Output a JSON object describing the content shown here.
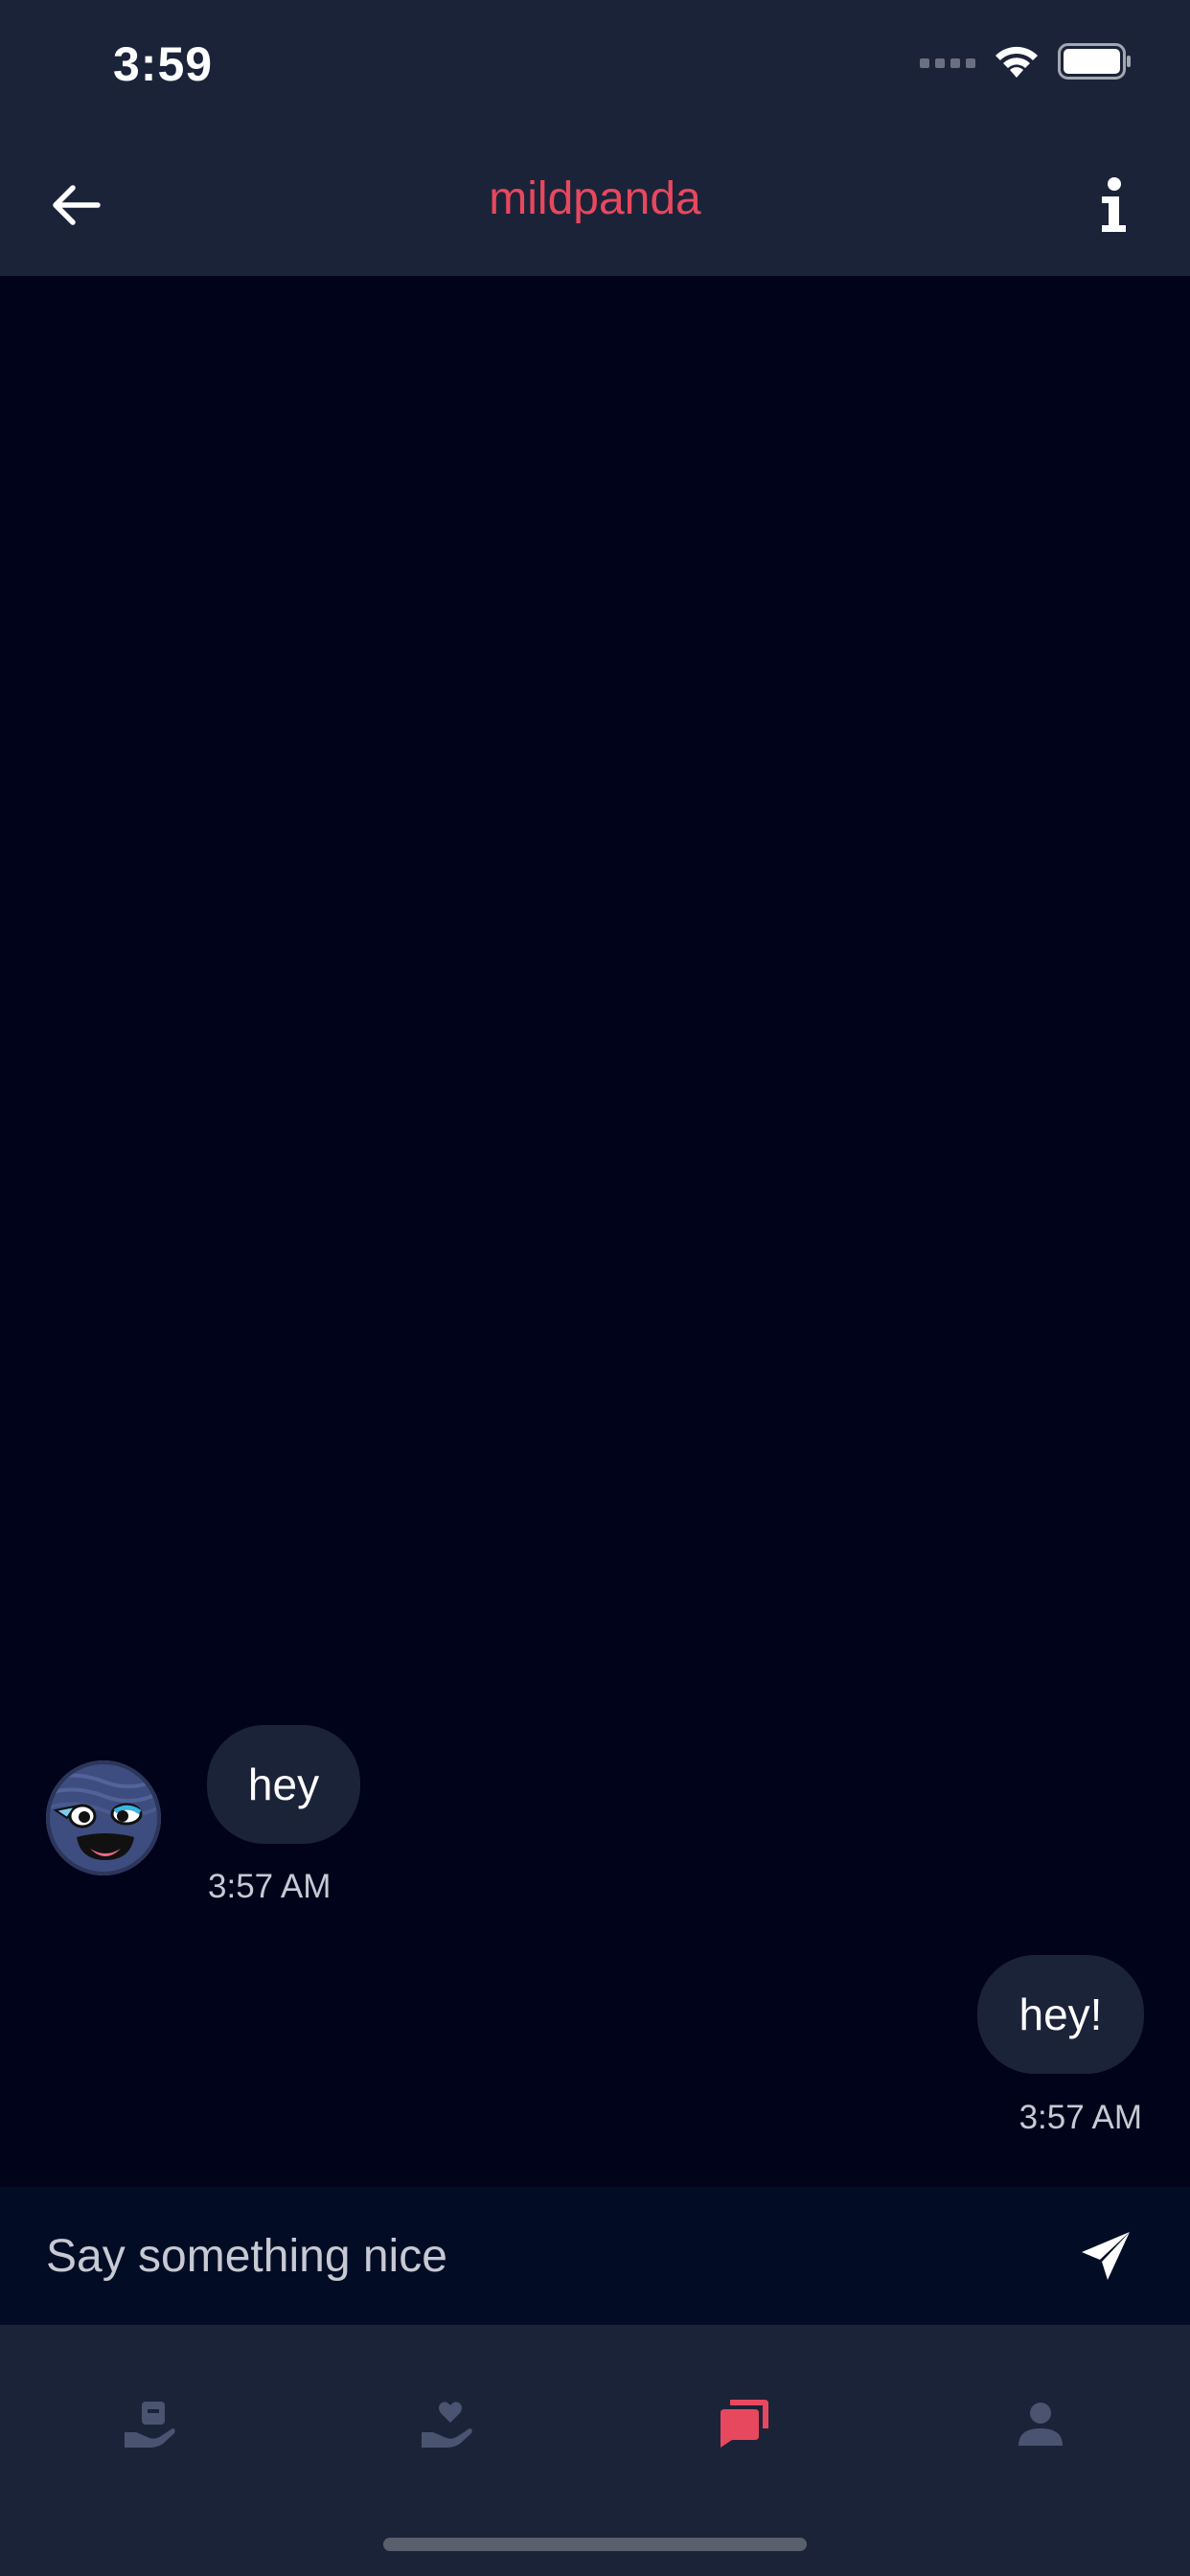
{
  "status_bar": {
    "time": "3:59"
  },
  "header": {
    "title": "mildpanda",
    "back_icon": "arrow-left-icon",
    "info_icon": "info-icon"
  },
  "messages": [
    {
      "direction": "incoming",
      "text": "hey",
      "time": "3:57 AM"
    },
    {
      "direction": "outgoing",
      "text": "hey!",
      "time": "3:57 AM"
    }
  ],
  "composer": {
    "placeholder": "Say something nice",
    "value": "",
    "send_icon": "send-icon"
  },
  "tab_bar": {
    "tabs": [
      {
        "name": "hand-box-icon",
        "active": false
      },
      {
        "name": "hand-heart-icon",
        "active": false
      },
      {
        "name": "chat-bubbles-icon",
        "active": true
      },
      {
        "name": "profile-icon",
        "active": false
      }
    ]
  },
  "colors": {
    "accent": "#e8485e",
    "background": "#01031b",
    "header_bg": "#1b2339",
    "bubble_bg": "#1b2339",
    "composer_bg": "#020d25",
    "inactive_icon": "#4a5470"
  }
}
